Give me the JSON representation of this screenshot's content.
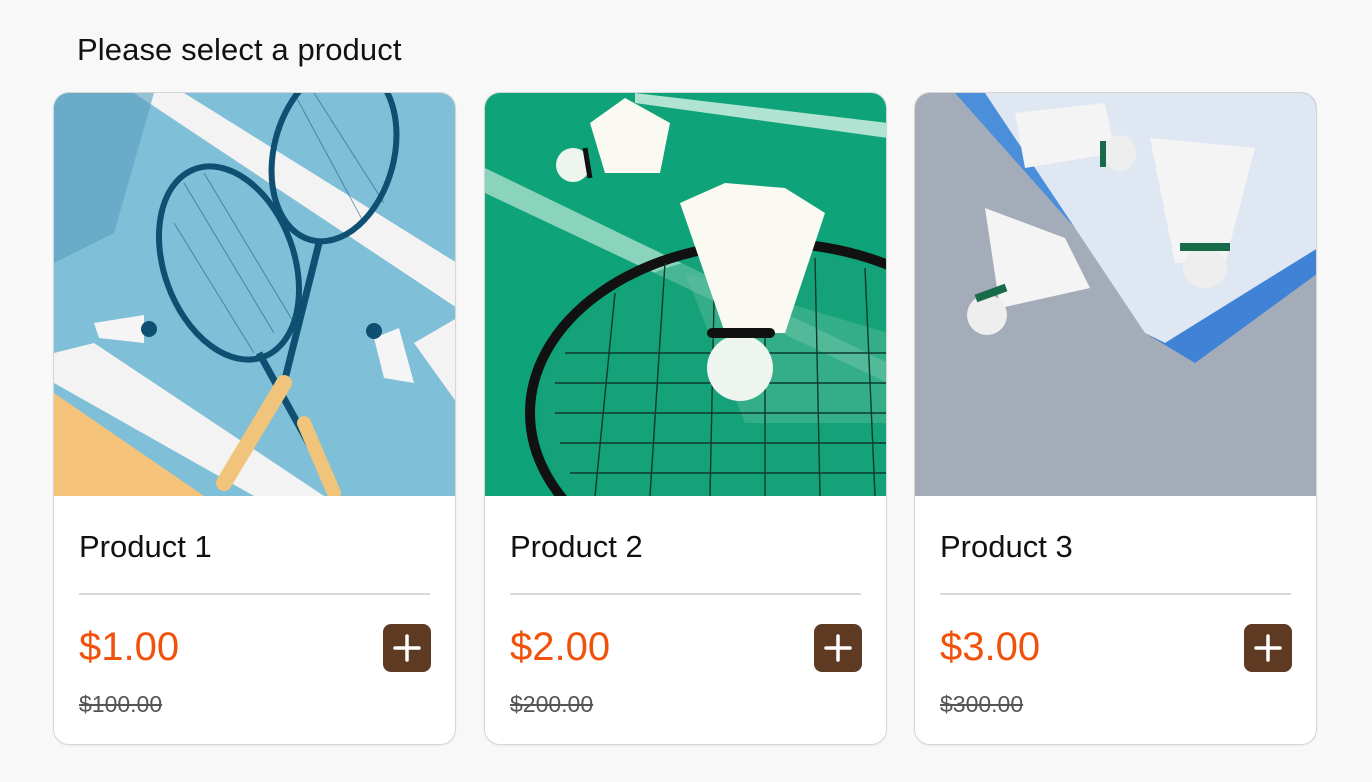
{
  "page": {
    "title": "Please select a product"
  },
  "products": [
    {
      "name": "Product 1",
      "price": "$1.00",
      "original_price": "$100.00",
      "image": "badminton-rackets-and-shuttlecocks-on-blue-court"
    },
    {
      "name": "Product 2",
      "price": "$2.00",
      "original_price": "$200.00",
      "image": "shuttlecock-on-racket-over-green-court"
    },
    {
      "name": "Product 3",
      "price": "$3.00",
      "original_price": "$300.00",
      "image": "three-shuttlecocks-on-grey-and-blue-surface"
    }
  ],
  "colors": {
    "price": "#f0520c",
    "add_button": "#5e3a23",
    "background": "#f8f8f8"
  },
  "icons": {
    "add": "plus-icon"
  }
}
